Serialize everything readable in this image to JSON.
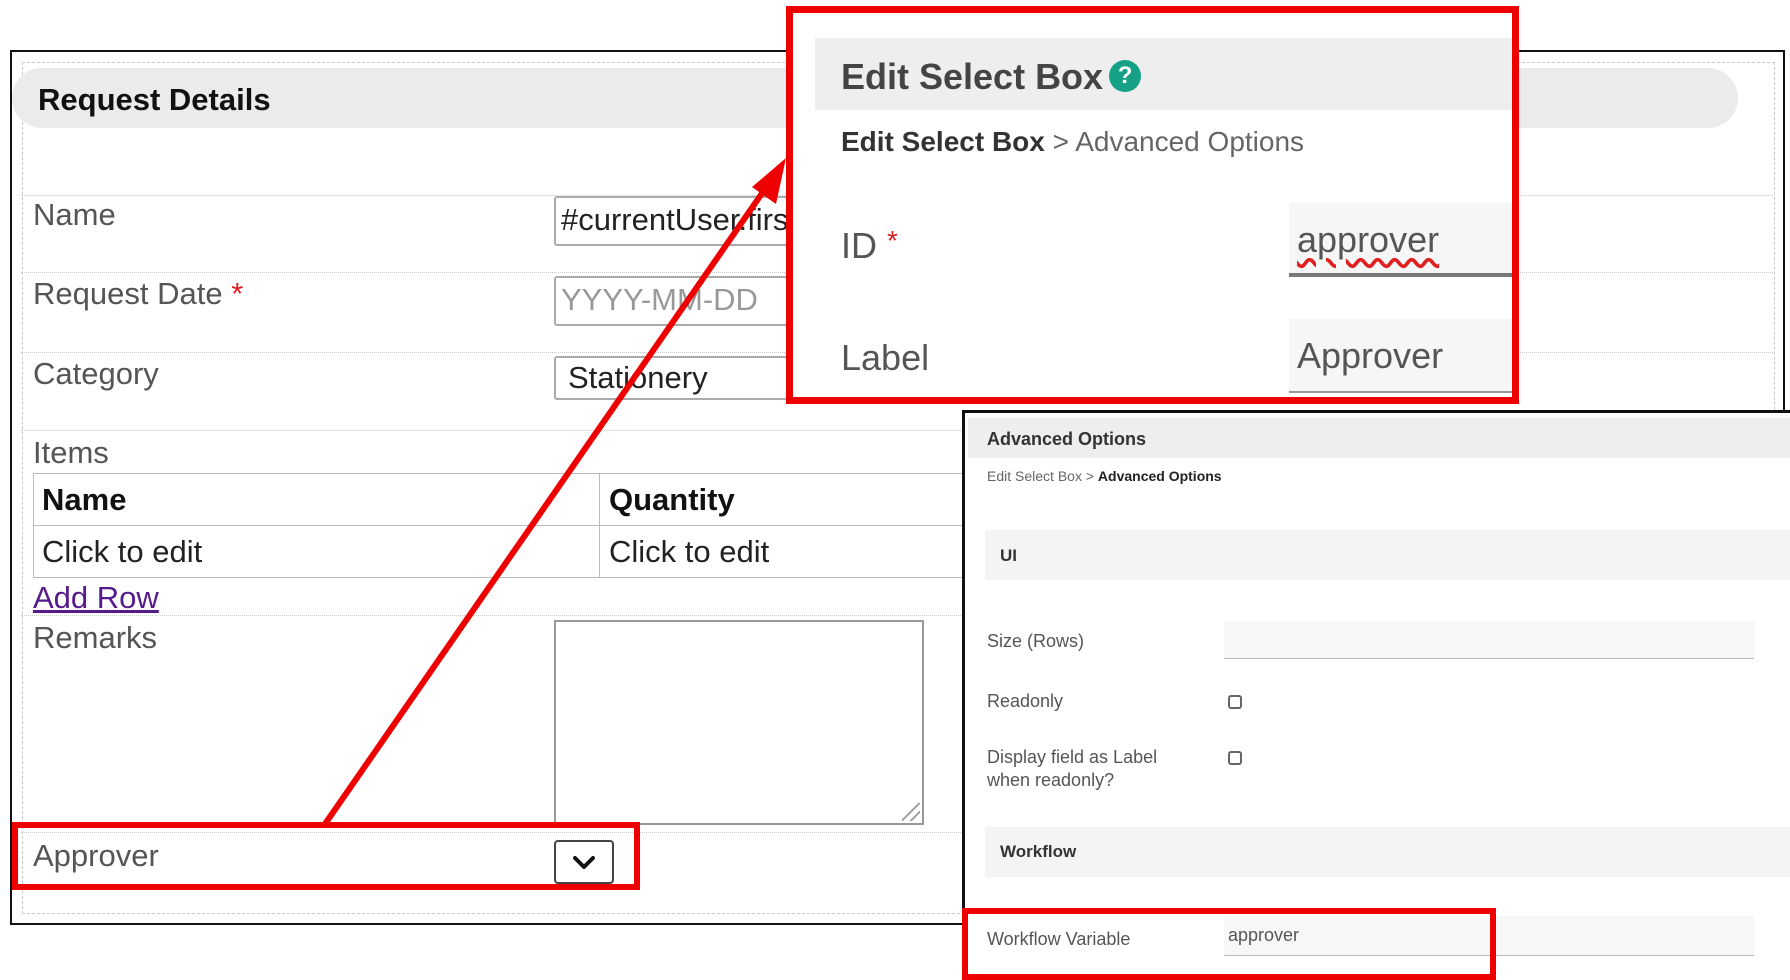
{
  "form": {
    "section_title": "Request Details",
    "fields": {
      "name_label": "Name",
      "name_value": "#currentUser.firstName",
      "request_date_label": "Request Date",
      "request_date_placeholder": "YYYY-MM-DD",
      "category_label": "Category",
      "category_value": "Stationery",
      "items_label": "Items",
      "remarks_label": "Remarks",
      "approver_label": "Approver"
    },
    "required_marker": "*",
    "items_table": {
      "columns": [
        "Name",
        "Quantity"
      ],
      "rows": [
        [
          "Click to edit",
          "Click to edit"
        ]
      ]
    },
    "add_row_label": "Add Row"
  },
  "edit_popup": {
    "title": "Edit Select Box",
    "help_icon": "?",
    "breadcrumb_parent": "Edit Select Box",
    "breadcrumb_separator": ">",
    "breadcrumb_current": "Advanced Options",
    "id_label": "ID",
    "id_value": "approver",
    "label_label": "Label",
    "label_value": "Approver"
  },
  "advanced_options": {
    "title": "Advanced Options",
    "breadcrumb_parent": "Edit Select Box",
    "breadcrumb_separator": ">",
    "breadcrumb_current": "Advanced Options",
    "ui_section": "UI",
    "size_rows_label": "Size (Rows)",
    "size_rows_value": "",
    "readonly_label": "Readonly",
    "readonly_checked": false,
    "display_as_label_label": "Display field as Label when readonly?",
    "display_as_label_checked": false,
    "workflow_section": "Workflow",
    "workflow_variable_label": "Workflow Variable",
    "workflow_variable_value": "approver"
  },
  "colors": {
    "highlight": "#ee0000",
    "help_icon": "#16a085",
    "link": "#551a8b",
    "required": "#e02020"
  }
}
